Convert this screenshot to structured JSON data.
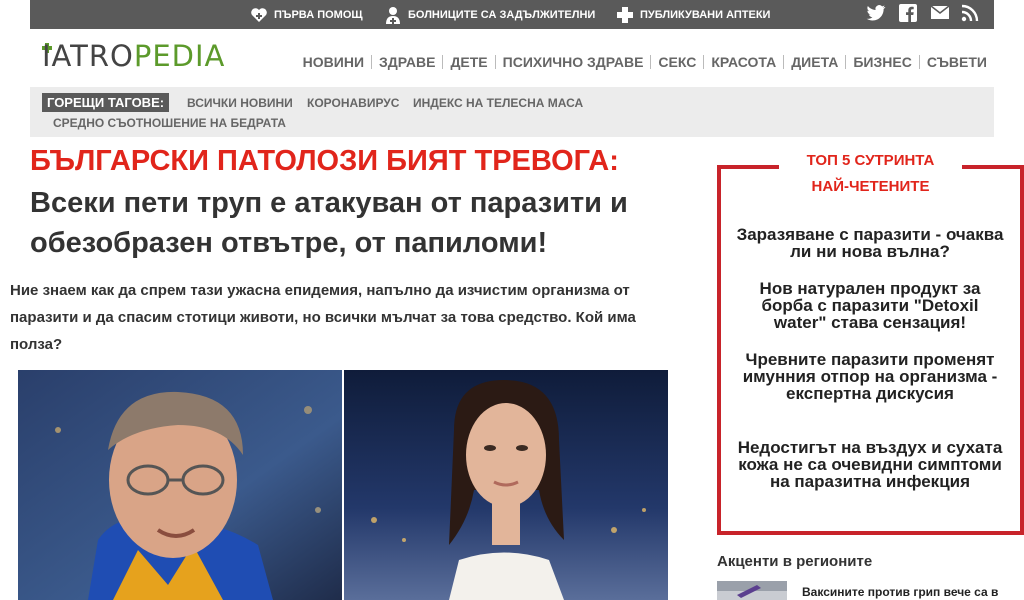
{
  "topbar": {
    "links": [
      {
        "label": "ПЪРВА ПОМОЩ",
        "icon": "first-aid-icon"
      },
      {
        "label": "БОЛНИЦИТЕ СА ЗАДЪЛЖИТЕЛНИ",
        "icon": "doctor-icon"
      },
      {
        "label": "ПУБЛИКУВАНИ АПТЕКИ",
        "icon": "pharmacy-cross-icon"
      }
    ],
    "social": [
      "twitter-icon",
      "facebook-icon",
      "mail-icon",
      "rss-icon"
    ]
  },
  "header": {
    "logo": {
      "part1": "IATRO",
      "part2": "PEDIA"
    },
    "nav": [
      "НОВИНИ",
      "ЗДРАВЕ",
      "ДЕТЕ",
      "ПСИХИЧНО ЗДРАВЕ",
      "СЕКС",
      "КРАСОТА",
      "ДИЕТА",
      "БИЗНЕС",
      "СЪВЕТИ"
    ]
  },
  "tags": {
    "label": "ГОРЕЩИ ТАГОВЕ:",
    "items": [
      "ВСИЧКИ НОВИНИ",
      "КОРОНАВИРУС",
      "ИНДЕКС НА ТЕЛЕСНА МАСА",
      "СРЕДНО СЪОТНОШЕНИЕ НА БЕДРАТА"
    ]
  },
  "article": {
    "kicker": "БЪЛГАРСКИ ПАТОЛОЗИ БИЯТ ТРЕВОГА:",
    "title": "Всеки пети труп е атакуван от паразити и обезобразен отвътре, от папиломи!",
    "lead": "Ние знаем как да спрем тази ужасна епидемия, напълно да изчистим организма от паразити и да спасим стотици животи, но всички мълчат за това средство. Кой има полза?"
  },
  "top5": {
    "title_line1": "ТОП 5 СУТРИНТА",
    "title_line2": "НАЙ-ЧЕТЕНИТЕ",
    "items": [
      "Заразяване с паразити - очаква ли ни нова вълна?",
      "Нов натурален продукт за борба с паразити \"Detoxil water\" става сензация!",
      "Чревните паразити променят имунния отпор на организма - експертна дискусия",
      "Недостигът на въздух и сухата кожа не са очевидни симптоми на паразитна инфекция"
    ]
  },
  "regions": {
    "title": "Акценти в регионите",
    "first_link": "Ваксините против грип вече са в"
  },
  "colors": {
    "accent_red": "#e1251b",
    "top5_border": "#c8232a",
    "topbar_bg": "#5a5a5a",
    "logo_green": "#5c9a2b"
  }
}
